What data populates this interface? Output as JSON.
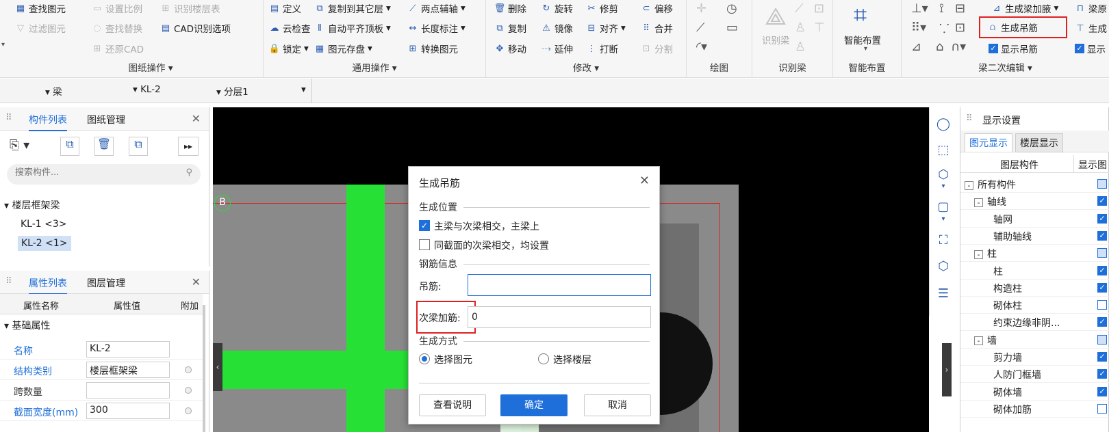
{
  "ribbon": {
    "g1": {
      "items": [
        "查找图元",
        "过滤图元"
      ],
      "label": "图纸操作"
    },
    "g2": {
      "items": [
        "设置比例",
        "查找替换",
        "还原CAD",
        "识别楼层表",
        "CAD识别选项"
      ]
    },
    "g3": {
      "items": [
        "定义",
        "云检查",
        "锁定",
        "复制到其它层",
        "自动平齐顶板",
        "图元存盘",
        "两点辅轴",
        "长度标注",
        "转换图元"
      ],
      "label": "通用操作"
    },
    "g4": {
      "items": [
        "删除",
        "复制",
        "移动",
        "旋转",
        "镜像",
        "延伸",
        "修剪",
        "对齐",
        "打断",
        "偏移",
        "合并",
        "分割"
      ],
      "label": "修改"
    },
    "g5": {
      "label": "绘图"
    },
    "g6": {
      "items": [
        "识别梁"
      ],
      "label": "识别梁"
    },
    "g7": {
      "items": [
        "智能布置"
      ],
      "label": "智能布置"
    },
    "g8": {
      "items": [
        "生成梁加腋",
        "生成吊筋",
        "显示吊筋",
        "梁原",
        "生成",
        "显示"
      ],
      "label": "梁二次编辑"
    }
  },
  "selectors": {
    "type": "梁",
    "component": "KL-2",
    "layer": "分层1"
  },
  "leftTop": {
    "tabs": [
      "构件列表",
      "图纸管理"
    ],
    "search_placeholder": "搜索构件...",
    "group": "楼层框架梁",
    "items": [
      "KL-1 <3>",
      "KL-2 <1>"
    ]
  },
  "leftBottom": {
    "tabs": [
      "属性列表",
      "图层管理"
    ],
    "headers": [
      "属性名称",
      "属性值",
      "附加"
    ],
    "section": "基础属性",
    "rows": [
      {
        "name": "名称",
        "value": "KL-2"
      },
      {
        "name": "结构类别",
        "value": "楼层框架梁"
      },
      {
        "name": "跨数量",
        "value": ""
      },
      {
        "name": "截面宽度(mm)",
        "value": "300"
      }
    ]
  },
  "axis_label": "B",
  "dialog": {
    "title": "生成吊筋",
    "sec1": "生成位置",
    "opt1": "主梁与次梁相交，主梁上",
    "opt2": "同截面的次梁相交，均设置",
    "sec2": "钢筋信息",
    "f1_label": "吊筋:",
    "f1_value": "",
    "f2_label": "次梁加筋:",
    "f2_value": "0",
    "sec3": "生成方式",
    "r1": "选择图元",
    "r2": "选择楼层",
    "btn_help": "查看说明",
    "btn_ok": "确定",
    "btn_cancel": "取消"
  },
  "right": {
    "title": "显示设置",
    "tabs": [
      "图元显示",
      "楼层显示"
    ],
    "headers": [
      "图层构件",
      "显示图"
    ],
    "rows": [
      {
        "t": "所有构件",
        "l": 0,
        "e": "-",
        "c": "part"
      },
      {
        "t": "轴线",
        "l": 1,
        "e": "-",
        "c": "on"
      },
      {
        "t": "轴网",
        "l": 2,
        "c": "on"
      },
      {
        "t": "辅助轴线",
        "l": 2,
        "c": "on"
      },
      {
        "t": "柱",
        "l": 1,
        "e": "-",
        "c": "part"
      },
      {
        "t": "柱",
        "l": 2,
        "c": "on"
      },
      {
        "t": "构造柱",
        "l": 2,
        "c": "on"
      },
      {
        "t": "砌体柱",
        "l": 2,
        "c": "off"
      },
      {
        "t": "约束边缘非阴...",
        "l": 2,
        "c": "on"
      },
      {
        "t": "墙",
        "l": 1,
        "e": "-",
        "c": "part"
      },
      {
        "t": "剪力墙",
        "l": 2,
        "c": "on"
      },
      {
        "t": "人防门框墙",
        "l": 2,
        "c": "on"
      },
      {
        "t": "砌体墙",
        "l": 2,
        "c": "on"
      },
      {
        "t": "砌体加筋",
        "l": 2,
        "c": "off"
      }
    ]
  }
}
